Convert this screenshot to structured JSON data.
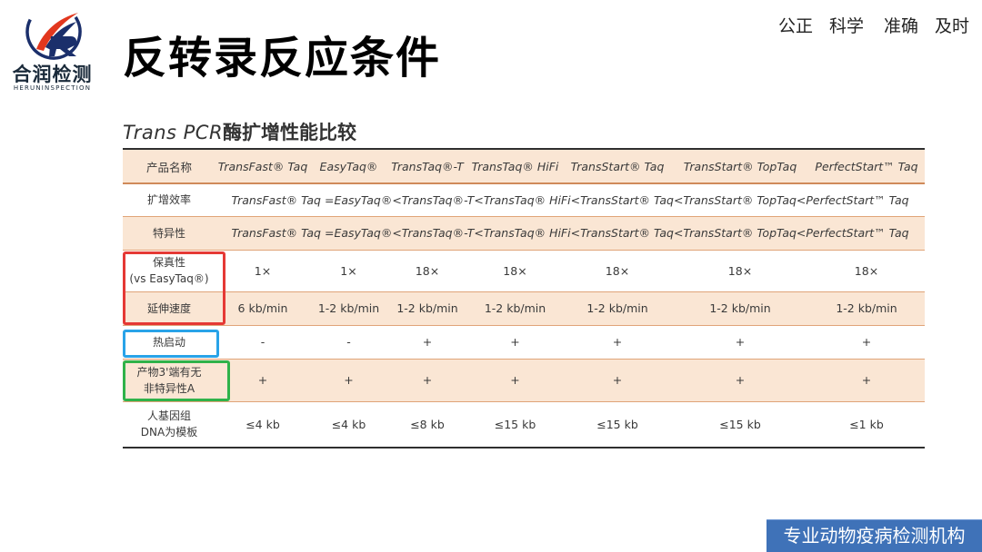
{
  "logo": {
    "name_cn": "合润检测",
    "name_en": "HERUNINSPECTION",
    "colors": {
      "red": "#e2371e",
      "navy": "#1b2f6b"
    }
  },
  "header": {
    "title": "反转录反应条件",
    "slogan": [
      "公正",
      "科学",
      "准确",
      "及时"
    ]
  },
  "table": {
    "title_prefix": "Trans PCR",
    "title_suffix": "酶扩增性能比较",
    "columns": [
      "产品名称",
      "TransFast® Taq",
      "EasyTaq®",
      "TransTaq®-T",
      "TransTaq® HiFi",
      "TransStart® Taq",
      "TransStart® TopTaq",
      "PerfectStart™ Taq"
    ],
    "row_efficiency": {
      "label": "扩增效率",
      "text": "TransFast® Taq =EasyTaq®<TransTaq®-T<TransTaq® HiFi<TransStart® Taq<TransStart® TopTaq<PerfectStart™ Taq"
    },
    "row_specificity": {
      "label": "特异性",
      "text": "TransFast® Taq =EasyTaq®<TransTaq®-T<TransTaq® HiFi<TransStart® Taq<TransStart® TopTaq<PerfectStart™ Taq"
    },
    "rows": [
      {
        "label_line1": "保真性",
        "label_line2": "(vs EasyTaq®)",
        "values": [
          "1×",
          "1×",
          "18×",
          "18×",
          "18×",
          "18×",
          "18×"
        ]
      },
      {
        "label_line1": "延伸速度",
        "label_line2": "",
        "values": [
          "6 kb/min",
          "1-2 kb/min",
          "1-2 kb/min",
          "1-2 kb/min",
          "1-2 kb/min",
          "1-2 kb/min",
          "1-2 kb/min"
        ]
      },
      {
        "label_line1": "热启动",
        "label_line2": "",
        "values": [
          "-",
          "-",
          "+",
          "+",
          "+",
          "+",
          "+"
        ]
      },
      {
        "label_line1": "产物3'端有无",
        "label_line2": "非特异性A",
        "values": [
          "+",
          "+",
          "+",
          "+",
          "+",
          "+",
          "+"
        ]
      },
      {
        "label_line1": "人基因组",
        "label_line2": "DNA为模板",
        "values": [
          "≤4 kb",
          "≤4 kb",
          "≤8 kb",
          "≤15 kb",
          "≤15 kb",
          "≤15 kb",
          "≤1 kb"
        ]
      }
    ],
    "highlight_colors": {
      "red": "#e53935",
      "blue": "#29a3e8",
      "green": "#2fb24a"
    }
  },
  "footer": {
    "badge": "专业动物疫病检测机构",
    "color": "#3f72b8"
  }
}
